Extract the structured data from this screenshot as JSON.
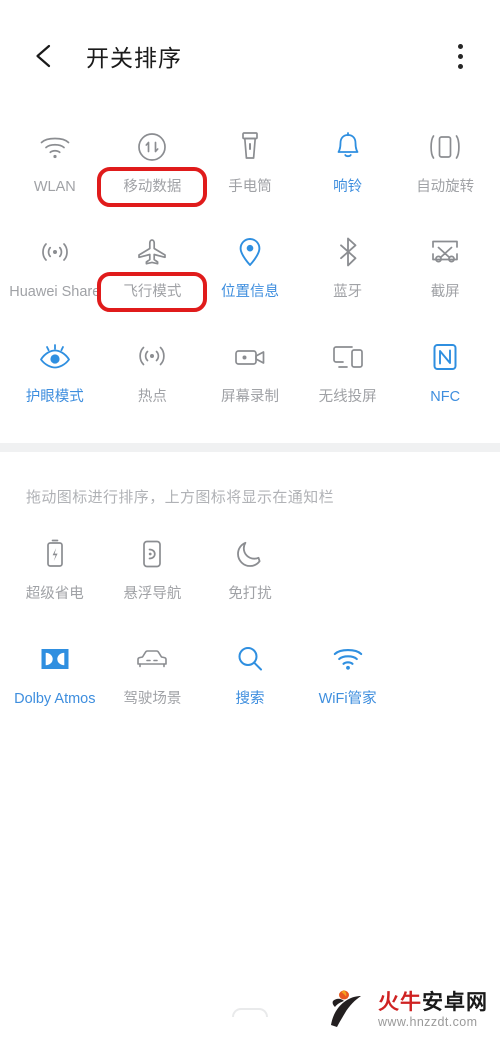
{
  "header": {
    "title": "开关排序",
    "back_icon": "arrow-left-icon",
    "more_icon": "more-vertical-icon"
  },
  "notification_panel": {
    "tiles": [
      {
        "label": "WLAN",
        "icon": "wifi-icon",
        "state": "gray",
        "highlighted": false
      },
      {
        "label": "移动数据",
        "icon": "mobile-data-icon",
        "state": "gray",
        "highlighted": true
      },
      {
        "label": "手电筒",
        "icon": "flashlight-icon",
        "state": "gray",
        "highlighted": false
      },
      {
        "label": "响铃",
        "icon": "bell-icon",
        "state": "blue",
        "highlighted": false
      },
      {
        "label": "自动旋转",
        "icon": "auto-rotate-icon",
        "state": "gray",
        "highlighted": false
      },
      {
        "label": "Huawei Share",
        "icon": "huawei-share-icon",
        "state": "gray",
        "highlighted": false
      },
      {
        "label": "飞行模式",
        "icon": "airplane-icon",
        "state": "gray",
        "highlighted": true
      },
      {
        "label": "位置信息",
        "icon": "location-pin-icon",
        "state": "blue",
        "highlighted": false
      },
      {
        "label": "蓝牙",
        "icon": "bluetooth-icon",
        "state": "gray",
        "highlighted": false
      },
      {
        "label": "截屏",
        "icon": "screenshot-icon",
        "state": "gray",
        "highlighted": false
      },
      {
        "label": "护眼模式",
        "icon": "eye-comfort-icon",
        "state": "blue",
        "highlighted": false
      },
      {
        "label": "热点",
        "icon": "hotspot-icon",
        "state": "gray",
        "highlighted": false
      },
      {
        "label": "屏幕录制",
        "icon": "screen-record-icon",
        "state": "gray",
        "highlighted": false
      },
      {
        "label": "无线投屏",
        "icon": "cast-screen-icon",
        "state": "gray",
        "highlighted": false
      },
      {
        "label": "NFC",
        "icon": "nfc-icon",
        "state": "blue",
        "highlighted": false
      }
    ]
  },
  "hint_text": "拖动图标进行排序，上方图标将显示在通知栏",
  "hidden_panel": {
    "row_one": [
      {
        "label": "超级省电",
        "icon": "battery-saver-icon",
        "state": "gray"
      },
      {
        "label": "悬浮导航",
        "icon": "floating-nav-icon",
        "state": "gray"
      },
      {
        "label": "免打扰",
        "icon": "moon-dnd-icon",
        "state": "gray"
      }
    ],
    "row_two": [
      {
        "label": "Dolby Atmos",
        "icon": "dolby-atmos-icon",
        "state": "blue"
      },
      {
        "label": "驾驶场景",
        "icon": "car-drive-icon",
        "state": "gray"
      },
      {
        "label": "搜索",
        "icon": "search-icon",
        "state": "blue"
      },
      {
        "label": "WiFi管家",
        "icon": "wifi-manager-icon",
        "state": "blue"
      }
    ]
  },
  "watermark": {
    "brand_red": "火牛",
    "brand_black": "安卓网",
    "url": "www.hnzzdt.com"
  },
  "colors": {
    "active_blue": "#3e8ede",
    "inactive_gray": "#a0a2a6",
    "highlight_red": "#e01b1b",
    "divider_gray": "#f0f1f2",
    "title_black": "#1a1a1a"
  }
}
